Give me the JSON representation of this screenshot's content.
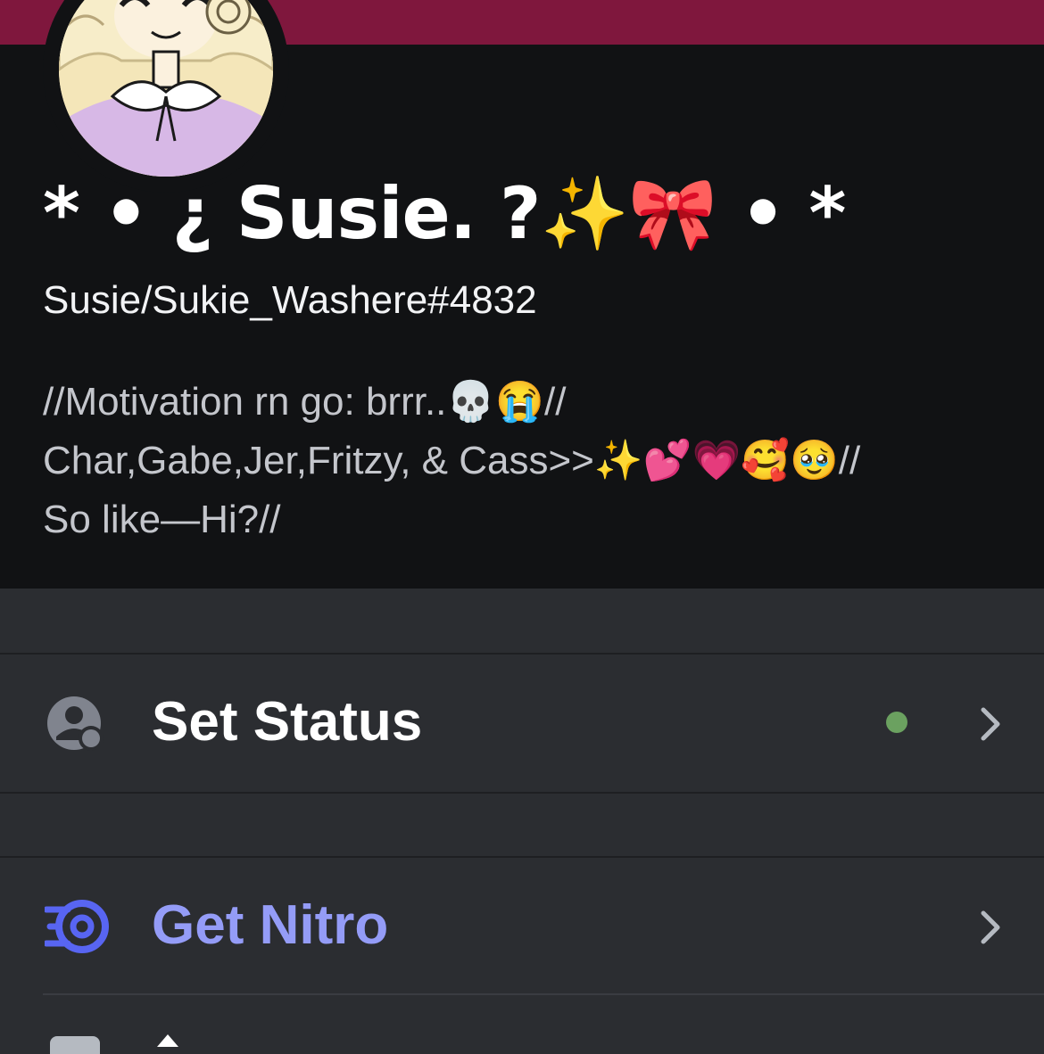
{
  "profile": {
    "display_name": "* • ¿ Susie.  ?✨🎀 • *",
    "username": "Susie/Sukie_Washere#4832",
    "bio_lines": [
      "//Motivation rn go: brrr..💀😭//",
      "Char,Gabe,Jer,Fritzy, & Cass>>✨💕💗🥰🥹//",
      "So like—Hi?//"
    ]
  },
  "menu": {
    "set_status": {
      "label": "Set Status",
      "icon": "user-status-icon",
      "status_color": "#6ba160"
    },
    "get_nitro": {
      "label": "Get Nitro",
      "icon": "nitro-icon",
      "label_color": "#949cf7"
    }
  },
  "colors": {
    "banner": "#7f173d",
    "card_background": "#111214",
    "page_background": "#2b2d31"
  }
}
